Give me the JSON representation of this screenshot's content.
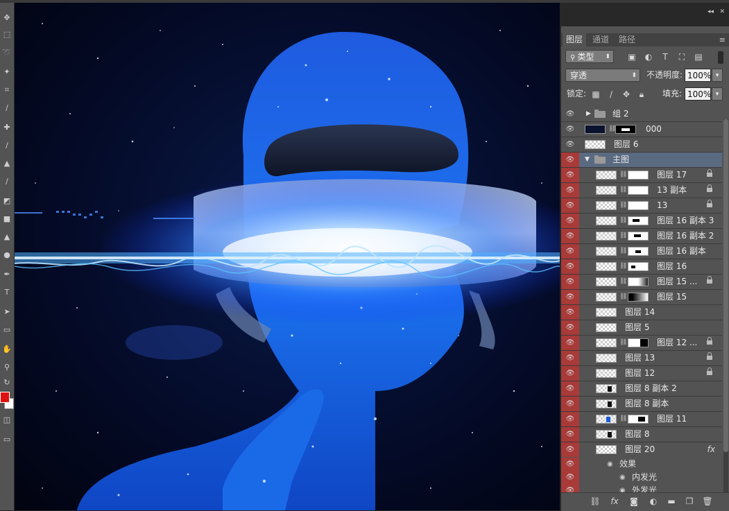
{
  "panel": {
    "tabs": [
      "图层",
      "通道",
      "路径"
    ],
    "filter_kind": "类型",
    "blend_mode": "穿透",
    "opacity_label": "不透明度:",
    "opacity_value": "100%",
    "lock_label": "锁定:",
    "fill_label": "填充:",
    "fill_value": "100%"
  },
  "layers": [
    {
      "name": "组 2",
      "type": "group-closed",
      "eye_red": false
    },
    {
      "name": "000",
      "type": "masked-dark",
      "eye_red": false
    },
    {
      "name": "图层 6",
      "type": "plain",
      "eye_red": false
    },
    {
      "name": "主图",
      "type": "group-open",
      "eye_red": true,
      "selected": true
    },
    {
      "name": "图层 17",
      "type": "masked",
      "eye_red": true,
      "lock": true
    },
    {
      "name": "13 副本",
      "type": "masked",
      "eye_red": true,
      "lock": true
    },
    {
      "name": "13",
      "type": "masked",
      "eye_red": true,
      "lock": true
    },
    {
      "name": "图层 16 副本 3",
      "type": "masked",
      "eye_red": true
    },
    {
      "name": "图层 16 副本 2",
      "type": "masked",
      "eye_red": true
    },
    {
      "name": "图层 16 副本",
      "type": "masked",
      "eye_red": true
    },
    {
      "name": "图层 16",
      "type": "masked",
      "eye_red": true
    },
    {
      "name": "图层 15 ...",
      "type": "masked",
      "eye_red": true,
      "lock": true
    },
    {
      "name": "图层 15",
      "type": "masked",
      "eye_red": true
    },
    {
      "name": "图层 14",
      "type": "plain",
      "eye_red": true
    },
    {
      "name": "图层 5",
      "type": "plain",
      "eye_red": true
    },
    {
      "name": "图层 12 ...",
      "type": "masked",
      "eye_red": true,
      "lock": true
    },
    {
      "name": "图层 13",
      "type": "plain",
      "eye_red": true,
      "lock": true
    },
    {
      "name": "图层 12",
      "type": "plain",
      "eye_red": true,
      "lock": true
    },
    {
      "name": "图层 8 副本 2",
      "type": "plain",
      "eye_red": true
    },
    {
      "name": "图层 8 副本",
      "type": "plain",
      "eye_red": true
    },
    {
      "name": "图层 11",
      "type": "masked",
      "eye_red": true
    },
    {
      "name": "图层 8",
      "type": "plain",
      "eye_red": true
    },
    {
      "name": "图层 20",
      "type": "plain",
      "eye_red": true,
      "fx": "fx"
    }
  ],
  "effects": {
    "header": "效果",
    "items": [
      "内发光",
      "外发光"
    ]
  },
  "tools": [
    "move-icon",
    "marquee-icon",
    "lasso-icon",
    "magic-wand-icon",
    "crop-icon",
    "eyedropper-icon",
    "healing-icon",
    "brush-icon",
    "stamp-icon",
    "history-brush-icon",
    "eraser-icon",
    "gradient-icon",
    "blur-icon",
    "dodge-icon",
    "pen-icon",
    "type-icon",
    "path-select-icon",
    "shape-icon",
    "hand-icon",
    "zoom-icon"
  ],
  "footer_icons": [
    "link-icon",
    "fx-icon",
    "mask-icon",
    "adjustment-icon",
    "folder-icon",
    "new-layer-icon",
    "trash-icon"
  ]
}
